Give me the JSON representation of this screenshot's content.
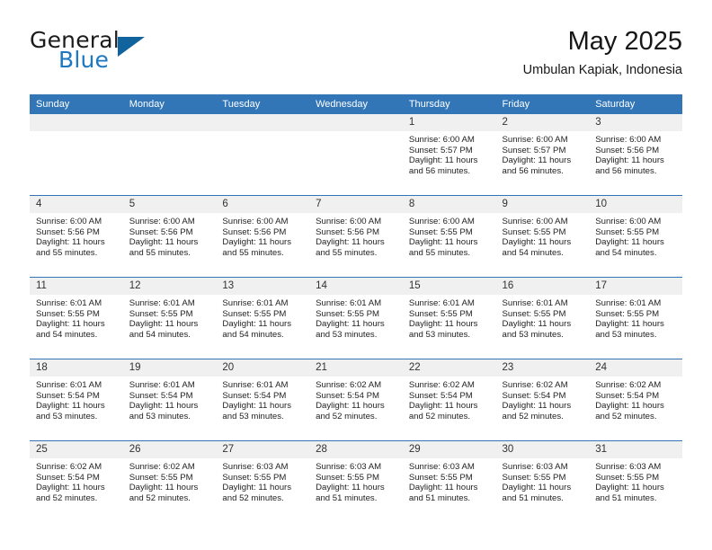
{
  "brand": {
    "name_part1": "General",
    "name_part2": "Blue",
    "logo_icon": "blue-triangle-icon"
  },
  "header": {
    "month_title": "May 2025",
    "location": "Umbulan Kapiak, Indonesia"
  },
  "theme": {
    "header_blue": "#3276b8",
    "brand_blue": "#1d78c1",
    "logo_blue": "#11639e",
    "daynum_band": "#f0f0f0",
    "text": "#232323"
  },
  "weekdays": [
    "Sunday",
    "Monday",
    "Tuesday",
    "Wednesday",
    "Thursday",
    "Friday",
    "Saturday"
  ],
  "weeks": [
    [
      {
        "day": "",
        "lines": []
      },
      {
        "day": "",
        "lines": []
      },
      {
        "day": "",
        "lines": []
      },
      {
        "day": "",
        "lines": []
      },
      {
        "day": "1",
        "lines": [
          "Sunrise: 6:00 AM",
          "Sunset: 5:57 PM",
          "Daylight: 11 hours",
          "and 56 minutes."
        ]
      },
      {
        "day": "2",
        "lines": [
          "Sunrise: 6:00 AM",
          "Sunset: 5:57 PM",
          "Daylight: 11 hours",
          "and 56 minutes."
        ]
      },
      {
        "day": "3",
        "lines": [
          "Sunrise: 6:00 AM",
          "Sunset: 5:56 PM",
          "Daylight: 11 hours",
          "and 56 minutes."
        ]
      }
    ],
    [
      {
        "day": "4",
        "lines": [
          "Sunrise: 6:00 AM",
          "Sunset: 5:56 PM",
          "Daylight: 11 hours",
          "and 55 minutes."
        ]
      },
      {
        "day": "5",
        "lines": [
          "Sunrise: 6:00 AM",
          "Sunset: 5:56 PM",
          "Daylight: 11 hours",
          "and 55 minutes."
        ]
      },
      {
        "day": "6",
        "lines": [
          "Sunrise: 6:00 AM",
          "Sunset: 5:56 PM",
          "Daylight: 11 hours",
          "and 55 minutes."
        ]
      },
      {
        "day": "7",
        "lines": [
          "Sunrise: 6:00 AM",
          "Sunset: 5:56 PM",
          "Daylight: 11 hours",
          "and 55 minutes."
        ]
      },
      {
        "day": "8",
        "lines": [
          "Sunrise: 6:00 AM",
          "Sunset: 5:55 PM",
          "Daylight: 11 hours",
          "and 55 minutes."
        ]
      },
      {
        "day": "9",
        "lines": [
          "Sunrise: 6:00 AM",
          "Sunset: 5:55 PM",
          "Daylight: 11 hours",
          "and 54 minutes."
        ]
      },
      {
        "day": "10",
        "lines": [
          "Sunrise: 6:00 AM",
          "Sunset: 5:55 PM",
          "Daylight: 11 hours",
          "and 54 minutes."
        ]
      }
    ],
    [
      {
        "day": "11",
        "lines": [
          "Sunrise: 6:01 AM",
          "Sunset: 5:55 PM",
          "Daylight: 11 hours",
          "and 54 minutes."
        ]
      },
      {
        "day": "12",
        "lines": [
          "Sunrise: 6:01 AM",
          "Sunset: 5:55 PM",
          "Daylight: 11 hours",
          "and 54 minutes."
        ]
      },
      {
        "day": "13",
        "lines": [
          "Sunrise: 6:01 AM",
          "Sunset: 5:55 PM",
          "Daylight: 11 hours",
          "and 54 minutes."
        ]
      },
      {
        "day": "14",
        "lines": [
          "Sunrise: 6:01 AM",
          "Sunset: 5:55 PM",
          "Daylight: 11 hours",
          "and 53 minutes."
        ]
      },
      {
        "day": "15",
        "lines": [
          "Sunrise: 6:01 AM",
          "Sunset: 5:55 PM",
          "Daylight: 11 hours",
          "and 53 minutes."
        ]
      },
      {
        "day": "16",
        "lines": [
          "Sunrise: 6:01 AM",
          "Sunset: 5:55 PM",
          "Daylight: 11 hours",
          "and 53 minutes."
        ]
      },
      {
        "day": "17",
        "lines": [
          "Sunrise: 6:01 AM",
          "Sunset: 5:55 PM",
          "Daylight: 11 hours",
          "and 53 minutes."
        ]
      }
    ],
    [
      {
        "day": "18",
        "lines": [
          "Sunrise: 6:01 AM",
          "Sunset: 5:54 PM",
          "Daylight: 11 hours",
          "and 53 minutes."
        ]
      },
      {
        "day": "19",
        "lines": [
          "Sunrise: 6:01 AM",
          "Sunset: 5:54 PM",
          "Daylight: 11 hours",
          "and 53 minutes."
        ]
      },
      {
        "day": "20",
        "lines": [
          "Sunrise: 6:01 AM",
          "Sunset: 5:54 PM",
          "Daylight: 11 hours",
          "and 53 minutes."
        ]
      },
      {
        "day": "21",
        "lines": [
          "Sunrise: 6:02 AM",
          "Sunset: 5:54 PM",
          "Daylight: 11 hours",
          "and 52 minutes."
        ]
      },
      {
        "day": "22",
        "lines": [
          "Sunrise: 6:02 AM",
          "Sunset: 5:54 PM",
          "Daylight: 11 hours",
          "and 52 minutes."
        ]
      },
      {
        "day": "23",
        "lines": [
          "Sunrise: 6:02 AM",
          "Sunset: 5:54 PM",
          "Daylight: 11 hours",
          "and 52 minutes."
        ]
      },
      {
        "day": "24",
        "lines": [
          "Sunrise: 6:02 AM",
          "Sunset: 5:54 PM",
          "Daylight: 11 hours",
          "and 52 minutes."
        ]
      }
    ],
    [
      {
        "day": "25",
        "lines": [
          "Sunrise: 6:02 AM",
          "Sunset: 5:54 PM",
          "Daylight: 11 hours",
          "and 52 minutes."
        ]
      },
      {
        "day": "26",
        "lines": [
          "Sunrise: 6:02 AM",
          "Sunset: 5:55 PM",
          "Daylight: 11 hours",
          "and 52 minutes."
        ]
      },
      {
        "day": "27",
        "lines": [
          "Sunrise: 6:03 AM",
          "Sunset: 5:55 PM",
          "Daylight: 11 hours",
          "and 52 minutes."
        ]
      },
      {
        "day": "28",
        "lines": [
          "Sunrise: 6:03 AM",
          "Sunset: 5:55 PM",
          "Daylight: 11 hours",
          "and 51 minutes."
        ]
      },
      {
        "day": "29",
        "lines": [
          "Sunrise: 6:03 AM",
          "Sunset: 5:55 PM",
          "Daylight: 11 hours",
          "and 51 minutes."
        ]
      },
      {
        "day": "30",
        "lines": [
          "Sunrise: 6:03 AM",
          "Sunset: 5:55 PM",
          "Daylight: 11 hours",
          "and 51 minutes."
        ]
      },
      {
        "day": "31",
        "lines": [
          "Sunrise: 6:03 AM",
          "Sunset: 5:55 PM",
          "Daylight: 11 hours",
          "and 51 minutes."
        ]
      }
    ]
  ]
}
